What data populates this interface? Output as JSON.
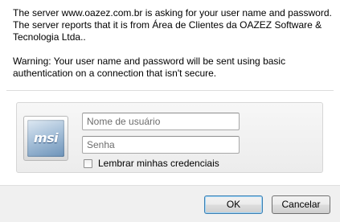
{
  "message": {
    "line1": "The server www.oazez.com.br is asking for your user name and password.",
    "line2": "The server reports that it is from Área de Clientes da OAZEZ Software &",
    "line3": "Tecnologia Ltda..",
    "line4": "Warning: Your user name and password will be sent using basic",
    "line5": "authentication on a connection that isn't secure."
  },
  "avatar": {
    "logo_text": "msi"
  },
  "credentials": {
    "username_placeholder": "Nome de usuário",
    "password_placeholder": "Senha",
    "remember_label": "Lembrar minhas credenciais",
    "remember_checked": false
  },
  "buttons": {
    "ok_label": "OK",
    "cancel_label": "Cancelar"
  }
}
